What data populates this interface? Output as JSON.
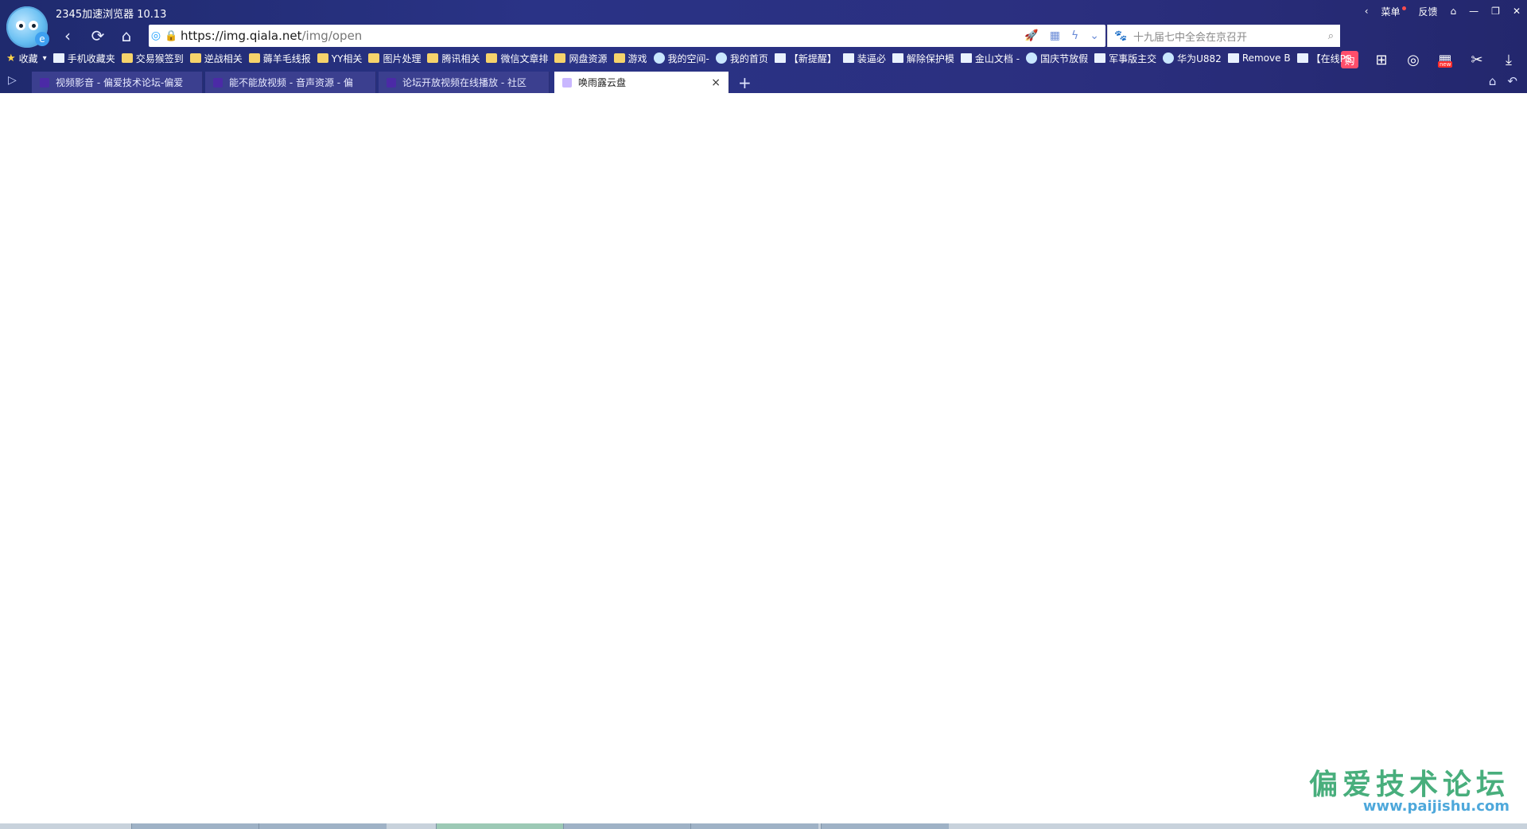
{
  "window": {
    "title": "2345加速浏览器 10.13",
    "controls": {
      "menu": "菜单",
      "feedback": "反馈"
    }
  },
  "address_bar": {
    "url_host": "https://img.qiala.net",
    "url_path": "/img/open"
  },
  "search": {
    "placeholder": "十九届七中全会在京召开"
  },
  "bookmarks": [
    {
      "label": "收藏",
      "icon": "star-icon"
    },
    {
      "label": "手机收藏夹",
      "icon": "page-icon"
    },
    {
      "label": "交易猴签到",
      "icon": "folder-icon"
    },
    {
      "label": "逆战相关",
      "icon": "folder-icon"
    },
    {
      "label": "薅羊毛线报",
      "icon": "folder-icon"
    },
    {
      "label": "YY相关",
      "icon": "folder-icon"
    },
    {
      "label": "图片处理",
      "icon": "folder-icon"
    },
    {
      "label": "腾讯相关",
      "icon": "folder-icon"
    },
    {
      "label": "微信文章排",
      "icon": "folder-icon"
    },
    {
      "label": "网盘资源",
      "icon": "folder-icon"
    },
    {
      "label": "游戏",
      "icon": "folder-icon"
    },
    {
      "label": "我的空间-",
      "icon": "globe-icon"
    },
    {
      "label": "我的首页",
      "icon": "globe-icon"
    },
    {
      "label": "【新提醒】",
      "icon": "page-icon"
    },
    {
      "label": "装逼必",
      "icon": "page-icon"
    },
    {
      "label": "解除保护模",
      "icon": "page-icon"
    },
    {
      "label": "金山文档 -",
      "icon": "page-icon"
    },
    {
      "label": "国庆节放假",
      "icon": "globe-icon"
    },
    {
      "label": "军事版主交",
      "icon": "page-icon"
    },
    {
      "label": "华为U882",
      "icon": "globe-icon"
    },
    {
      "label": "Remove B",
      "icon": "page-icon"
    },
    {
      "label": "【在线PS",
      "icon": "page-icon"
    }
  ],
  "tabs": [
    {
      "label": "视频影音 - 偏爱技术论坛-偏爱"
    },
    {
      "label": "能不能放视频 - 音声资源 - 偏"
    },
    {
      "label": "论坛开放视频在线播放 - 社区"
    },
    {
      "label": "唤雨露云盘"
    }
  ],
  "watermark": {
    "cn": "偏爱技术论坛",
    "en": "www.paijishu.com"
  },
  "icons": {
    "back": "back-icon",
    "refresh": "refresh-icon",
    "home": "home-icon",
    "rocket": "rocket-icon",
    "qr": "qr-icon",
    "lightning": "lightning-icon",
    "chevron": "chevron-down-icon",
    "search": "search-icon"
  },
  "colors": {
    "chrome_bg": "#2a3386",
    "active_tab": "#ffffff",
    "watermark_green": "#2fa36b",
    "watermark_blue": "#3b9fd8"
  }
}
